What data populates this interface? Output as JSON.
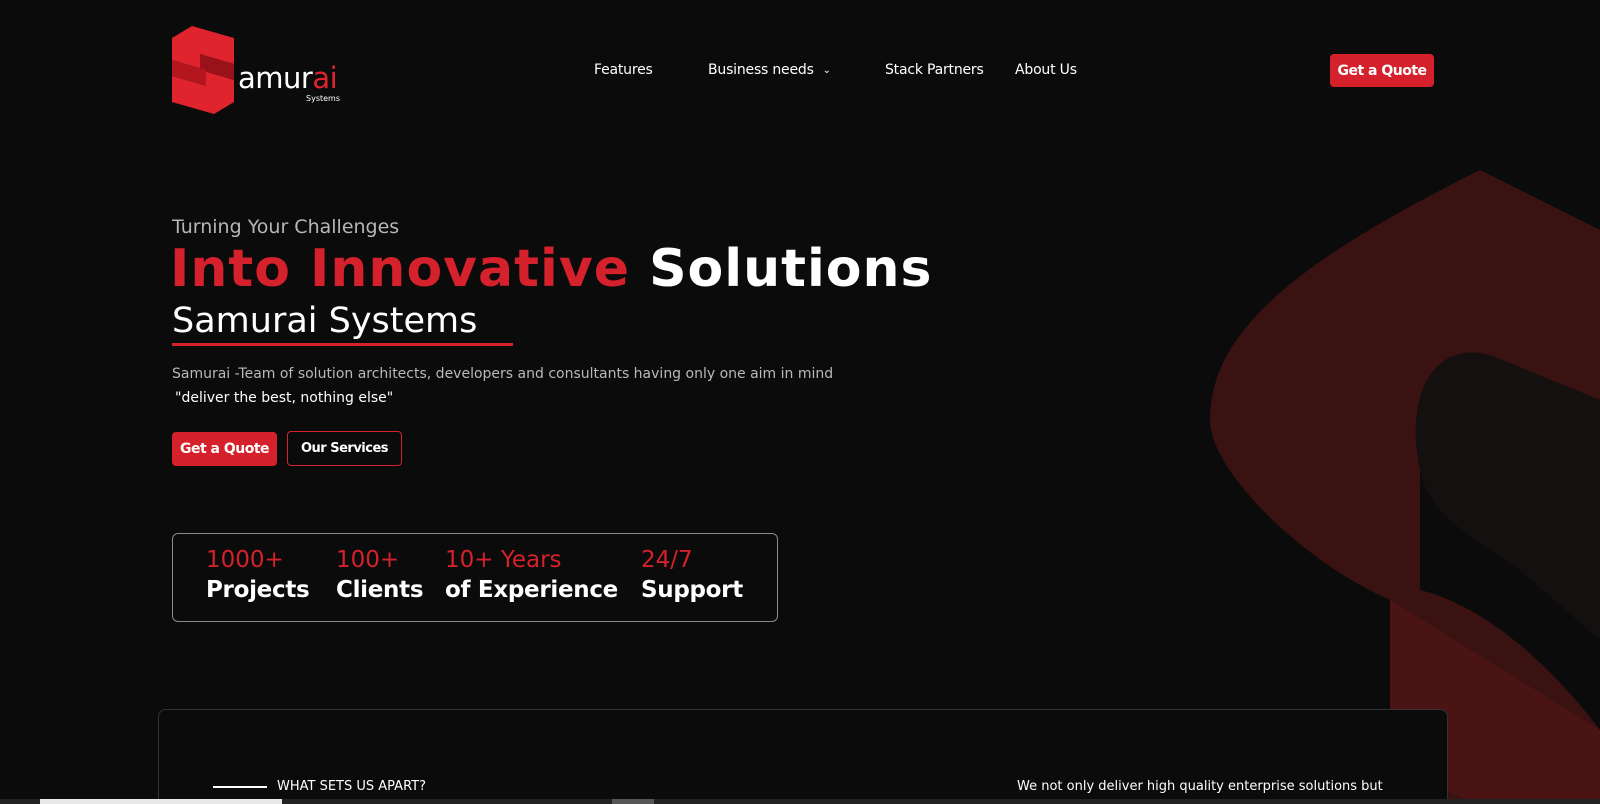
{
  "colors": {
    "accent": "#d4212b",
    "background": "#0b0b0b",
    "text": "#ffffff",
    "muted": "#b6b6b6"
  },
  "logo": {
    "word_main": "amur",
    "word_accent": "ai",
    "subtitle": "Systems"
  },
  "nav": {
    "items": [
      {
        "label": "Features"
      },
      {
        "label": "Business needs",
        "icon": "chevron-down-icon"
      },
      {
        "label": "Stack Partners"
      },
      {
        "label": "About Us"
      }
    ],
    "cta_label": "Get a Quote"
  },
  "hero": {
    "kicker": "Turning Your Challenges",
    "title_red": "Into Innovative",
    "title_white": "Solutions",
    "subtitle": "Samurai Systems",
    "description": "Samurai -Team of solution architects, developers and consultants having only one aim in mind",
    "quote": "\"deliver the best, nothing else\"",
    "primary_button": "Get a Quote",
    "secondary_button": "Our Services"
  },
  "stats": [
    {
      "top": "1000+",
      "bottom": "Projects"
    },
    {
      "top": "100+",
      "bottom": "Clients"
    },
    {
      "top": "10+ Years",
      "bottom": "of Experience"
    },
    {
      "top": "24/7",
      "bottom": "Support"
    }
  ],
  "section": {
    "label": "WHAT SETS US APART?",
    "text": "We not only deliver high quality enterprise solutions but"
  }
}
